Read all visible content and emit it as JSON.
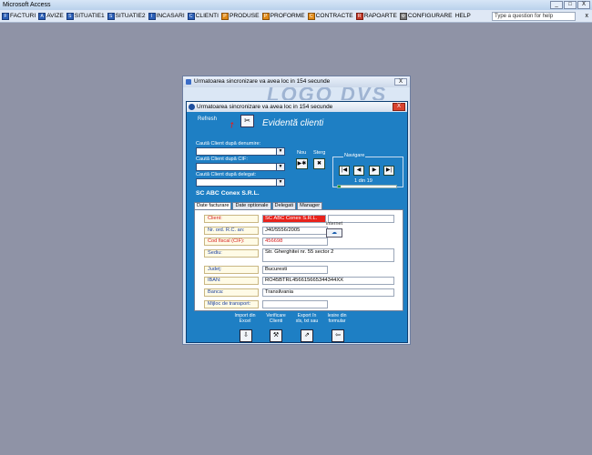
{
  "app": {
    "title": "Microsoft Access",
    "minimize": "_",
    "maximize": "□",
    "close": "X"
  },
  "menu": {
    "items": [
      {
        "label": "FACTURI",
        "icon": "F"
      },
      {
        "label": "AVIZE",
        "icon": "A"
      },
      {
        "label": "SITUATIE1",
        "icon": "S"
      },
      {
        "label": "SITUATIE2",
        "icon": "S"
      },
      {
        "label": "INCASARI",
        "icon": "I"
      },
      {
        "label": "CLIENTI",
        "icon": "C"
      },
      {
        "label": "PRODUSE",
        "icon": "P"
      },
      {
        "label": "PROFORME",
        "icon": "P"
      },
      {
        "label": "CONTRACTE",
        "icon": "C"
      },
      {
        "label": "RAPOARTE",
        "icon": "R"
      },
      {
        "label": "CONFIGURARE",
        "icon": "⚙"
      },
      {
        "label": "HELP",
        "icon": ""
      }
    ],
    "help_placeholder": "Type a question for help",
    "help_close": "x"
  },
  "outer_window": {
    "title": "Urmatoarea sincronizare va avea loc in 154 secunde",
    "close": "X",
    "logo": "LOGO DVS"
  },
  "form": {
    "title": "Urmatoarea sincronizare va avea loc in 154 secunde",
    "close": "X",
    "refresh_label": "Refresh",
    "heading": "Evidentă clienti",
    "search_by_name": "Caută Client după denumire:",
    "search_by_cif": "Caută Client după CIF:",
    "search_by_delegate": "Caută Client după delegat:",
    "new_label": "Nou",
    "delete_label": "Sterg",
    "new_icon": "▶✱",
    "delete_icon": "✖",
    "nav_label": "Navigare",
    "nav": {
      "first": "|◀",
      "prev": "◀",
      "next": "▶",
      "last": "▶|"
    },
    "record_counter": "1  din  19",
    "record_progress": 0.05,
    "company_name": "SC ABC Conex S.R.L."
  },
  "tabs": [
    {
      "label": "Date facturare",
      "active": true
    },
    {
      "label": "Date optionale",
      "active": false
    },
    {
      "label": "Delegati",
      "active": false
    },
    {
      "label": "Manager",
      "active": false
    }
  ],
  "fields": {
    "client": {
      "label": "Client:",
      "value": "SC ABC Conex S.R.L."
    },
    "reg": {
      "label": "Nr. ord. R.C. an:",
      "value": "J40/5556/2005"
    },
    "cif": {
      "label": "Cod fiscal (CIF):",
      "value": "456698"
    },
    "sediu": {
      "label": "Sediu:",
      "value": "Str. Gherghitei nr. 55 sector 2"
    },
    "judet": {
      "label": "Judeţ:",
      "value": "Bucuresti"
    },
    "iban": {
      "label": "IBAN:",
      "value": "RO45BTRL456615665344344XX"
    },
    "banca": {
      "label": "Banca:",
      "value": "Transilvania"
    },
    "transport": {
      "label": "Mijloc de transport:",
      "value": ""
    },
    "internet_label": "internet",
    "internet_icon": "☁"
  },
  "actions": {
    "import": {
      "label_line1": "Import din",
      "label_line2": "Excel",
      "icon": "⇩"
    },
    "verify": {
      "label_line1": "Verificare",
      "label_line2": "Clienti",
      "icon": "⚒"
    },
    "export": {
      "label_line1": "Export în",
      "label_line2": "xls, txt sau",
      "icon": "⇗"
    },
    "exit": {
      "label_line1": "Iesire din",
      "label_line2": "formular",
      "icon": "⇦"
    }
  }
}
